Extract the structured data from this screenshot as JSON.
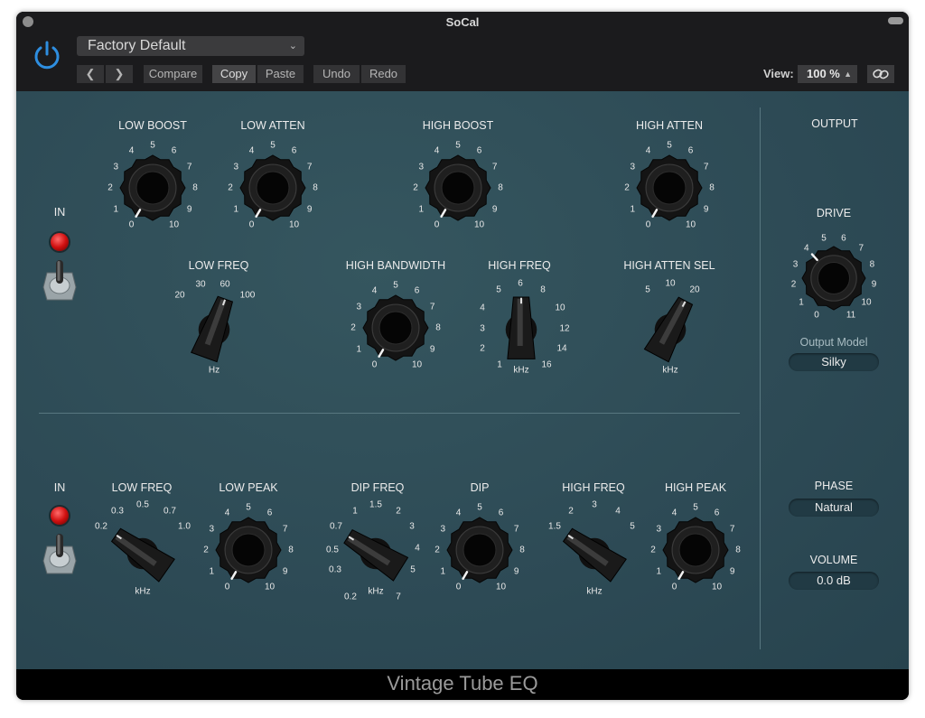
{
  "window": {
    "title": "SoCal"
  },
  "header": {
    "preset": "Factory Default",
    "compare": "Compare",
    "copy": "Copy",
    "paste": "Paste",
    "undo": "Undo",
    "redo": "Redo",
    "view_label": "View:",
    "zoom": "100 %"
  },
  "footer": {
    "product_name": "Vintage Tube EQ"
  },
  "colors": {
    "panel": "#2c4b57",
    "lamp": "#e01818",
    "titlebar": "#1b1b1d"
  },
  "controls": {
    "in_upper": "IN",
    "in_lower": "IN",
    "low_boost": {
      "label": "LOW BOOST",
      "ticks": [
        "0",
        "1",
        "2",
        "3",
        "4",
        "5",
        "6",
        "7",
        "8",
        "9",
        "10"
      ],
      "value": 0
    },
    "low_atten": {
      "label": "LOW ATTEN",
      "ticks": [
        "0",
        "1",
        "2",
        "3",
        "4",
        "5",
        "6",
        "7",
        "8",
        "9",
        "10"
      ],
      "value": 0
    },
    "high_boost": {
      "label": "HIGH BOOST",
      "ticks": [
        "0",
        "1",
        "2",
        "3",
        "4",
        "5",
        "6",
        "7",
        "8",
        "9",
        "10"
      ],
      "value": 0
    },
    "high_atten": {
      "label": "HIGH ATTEN",
      "ticks": [
        "0",
        "1",
        "2",
        "3",
        "4",
        "5",
        "6",
        "7",
        "8",
        "9",
        "10"
      ],
      "value": 0
    },
    "low_freq_top": {
      "label": "LOW FREQ",
      "ticks": [
        "20",
        "30",
        "60",
        "100"
      ],
      "unit": "Hz"
    },
    "high_bandwidth": {
      "label": "HIGH BANDWIDTH",
      "ticks": [
        "0",
        "1",
        "2",
        "3",
        "4",
        "5",
        "6",
        "7",
        "8",
        "9",
        "10"
      ],
      "value": 0
    },
    "high_freq_top": {
      "label": "HIGH FREQ",
      "ticks": [
        "1",
        "2",
        "3",
        "4",
        "5",
        "6",
        "8",
        "10",
        "12",
        "14",
        "16"
      ],
      "unit": "kHz"
    },
    "high_atten_sel": {
      "label": "HIGH ATTEN SEL",
      "ticks": [
        "5",
        "10",
        "20"
      ],
      "unit": "kHz"
    },
    "low_freq_bottom": {
      "label": "LOW FREQ",
      "ticks": [
        "0.2",
        "0.3",
        "0.5",
        "0.7",
        "1.0"
      ],
      "unit": "kHz"
    },
    "low_peak": {
      "label": "LOW PEAK",
      "ticks": [
        "0",
        "1",
        "2",
        "3",
        "4",
        "5",
        "6",
        "7",
        "8",
        "9",
        "10"
      ],
      "value": 0
    },
    "dip_freq": {
      "label": "DIP FREQ",
      "ticks": [
        "0.2",
        "0.3",
        "0.5",
        "0.7",
        "1",
        "1.5",
        "2",
        "3",
        "4",
        "5",
        "7"
      ],
      "unit": "kHz"
    },
    "dip": {
      "label": "DIP",
      "ticks": [
        "0",
        "1",
        "2",
        "3",
        "4",
        "5",
        "6",
        "7",
        "8",
        "9",
        "10"
      ],
      "value": 0
    },
    "high_freq_bottom": {
      "label": "HIGH FREQ",
      "ticks": [
        "1.5",
        "2",
        "3",
        "4",
        "5"
      ],
      "unit": "kHz"
    },
    "high_peak": {
      "label": "HIGH PEAK",
      "ticks": [
        "0",
        "1",
        "2",
        "3",
        "4",
        "5",
        "6",
        "7",
        "8",
        "9",
        "10"
      ],
      "value": 0
    }
  },
  "output": {
    "title": "OUTPUT",
    "drive": {
      "label": "DRIVE",
      "ticks": [
        "0",
        "1",
        "2",
        "3",
        "4",
        "5",
        "6",
        "7",
        "8",
        "9",
        "10",
        "11"
      ],
      "value": 4
    },
    "model_label": "Output Model",
    "model_value": "Silky",
    "phase_label": "PHASE",
    "phase_value": "Natural",
    "volume_label": "VOLUME",
    "volume_value": "0.0 dB"
  }
}
